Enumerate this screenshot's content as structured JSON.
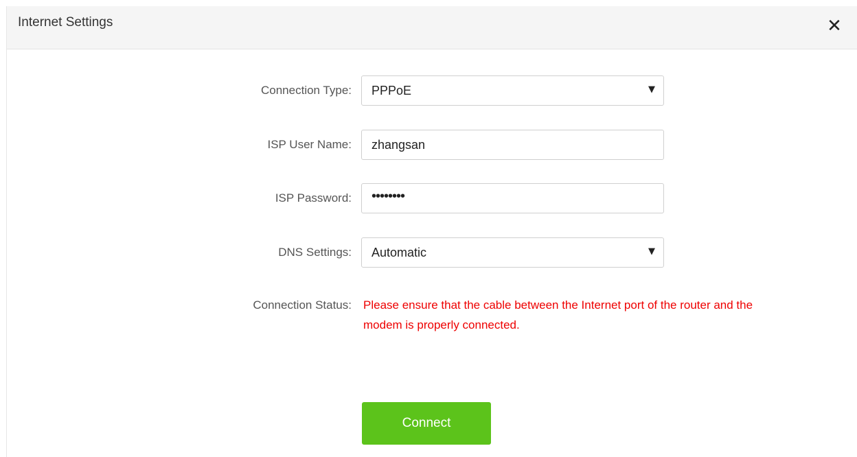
{
  "dialog": {
    "title": "Internet Settings",
    "close_glyph": "✕"
  },
  "form": {
    "connection_type": {
      "label": "Connection Type:",
      "value": "PPPoE"
    },
    "isp_user_name": {
      "label": "ISP User Name:",
      "value": "zhangsan"
    },
    "isp_password": {
      "label": "ISP Password:",
      "value": "••••••••"
    },
    "dns_settings": {
      "label": "DNS Settings:",
      "value": "Automatic"
    },
    "connection_status": {
      "label": "Connection Status:",
      "line1": "Please ensure that the cable between the Internet port of the router and the",
      "line2": "modem is properly connected."
    }
  },
  "actions": {
    "connect_label": "Connect"
  },
  "colors": {
    "accent": "#5cc31b",
    "error": "#ee0000"
  }
}
